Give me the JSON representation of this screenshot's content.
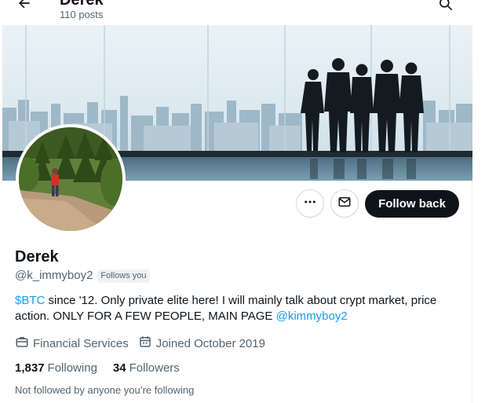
{
  "header": {
    "title": "Derek",
    "posts_count": "110 posts"
  },
  "icons": {
    "back": "arrow-left-icon",
    "search": "search-icon",
    "more": "more-horizontal-icon",
    "message": "envelope-icon",
    "category": "briefcase-icon",
    "joined": "calendar-icon"
  },
  "actions": {
    "follow_back_label": "Follow back"
  },
  "profile": {
    "name": "Derek",
    "handle": "@k_immyboy2",
    "follows_you": "Follows you",
    "bio": {
      "cashtag": "$BTC",
      "text_1": " since '12. Only private elite here! I will mainly talk about crypt market, price action. ONLY FOR A FEW PEOPLE, MAIN PAGE ",
      "mention": "@kimmyboy2"
    },
    "category": "Financial Services",
    "joined": "Joined October 2019",
    "following_count": "1,837",
    "following_label": "Following",
    "followers_count": "34",
    "followers_label": "Followers",
    "not_followed": "Not followed by anyone you’re following"
  },
  "colors": {
    "accent": "#1d9bf0",
    "primary_button": "#0f1419",
    "secondary_text": "#536471",
    "border": "#cfd9de"
  }
}
